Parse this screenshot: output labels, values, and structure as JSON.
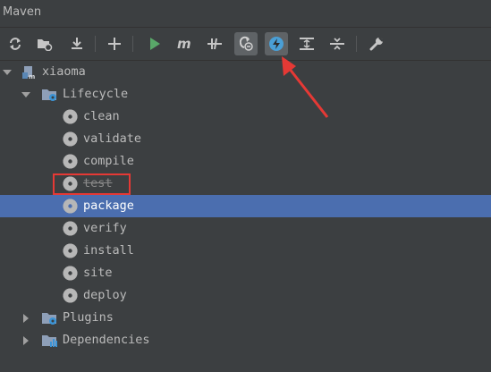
{
  "window": {
    "title": "Maven"
  },
  "toolbar": {
    "buttons": [
      {
        "name": "reimport-icon"
      },
      {
        "name": "generate-sources-icon"
      },
      {
        "name": "download-icon"
      },
      {
        "name": "add-maven-project-icon"
      },
      {
        "name": "run-icon"
      },
      {
        "name": "execute-goal-icon"
      },
      {
        "name": "toggle-offline-icon"
      },
      {
        "name": "skip-tests-icon",
        "pressed": true
      },
      {
        "name": "show-dependencies-icon",
        "pressed": true
      },
      {
        "name": "expand-all-icon"
      },
      {
        "name": "collapse-all-icon"
      },
      {
        "name": "settings-icon"
      }
    ]
  },
  "tree": {
    "project": "xiaoma",
    "lifecycle": {
      "label": "Lifecycle",
      "goals": [
        "clean",
        "validate",
        "compile",
        "test",
        "package",
        "verify",
        "install",
        "site",
        "deploy"
      ],
      "selected": "package",
      "skipped": "test"
    },
    "plugins": "Plugins",
    "dependencies": "Dependencies"
  },
  "colors": {
    "background": "#3c3f41",
    "selection": "#4b6eaf",
    "annotation": "#e53935",
    "run_green": "#59a869",
    "pressed_button_bg": "#5f6366"
  }
}
